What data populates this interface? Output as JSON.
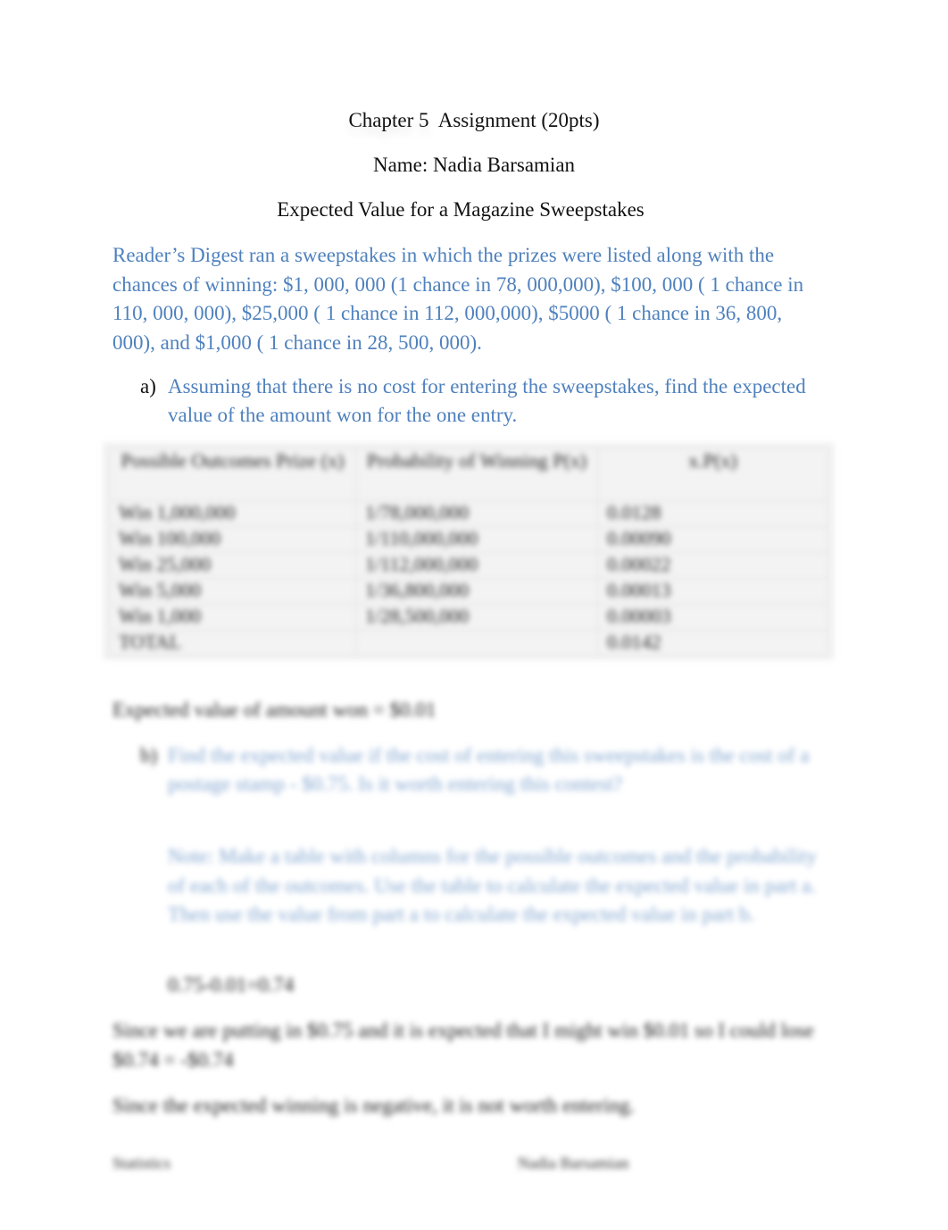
{
  "document": {
    "title_chapter": "Chapter 5",
    "title_rest": "Assignment (20pts)",
    "name_line": "Name: Nadia Barsamian",
    "subtitle": "Expected Value for a Magazine Sweepstakes",
    "intro": "Reader’s Digest ran a sweepstakes in which the prizes were listed along with the chances of winning: $1, 000, 000 (1 chance in 78, 000,000), $100, 000 ( 1 chance in 110, 000, 000), $25,000 ( 1 chance in 112, 000,000),  $5000 ( 1 chance in 36, 800, 000), and $1,000 ( 1 chance in 28, 500, 000).",
    "question_a": {
      "label": "a)",
      "text": "Assuming that there is no cost for entering the sweepstakes, find the expected value of the amount won for the one entry."
    },
    "table": {
      "headers": [
        "Possible Outcomes Prize (x)",
        "Probability of Winning P(x)",
        "x.P(x)"
      ],
      "rows": [
        [
          "Win 1,000,000",
          "1/78,000,000",
          "0.0128"
        ],
        [
          "Win 100,000",
          "1/110,000,000",
          "0.00090"
        ],
        [
          "Win 25,000",
          "1/112,000,000",
          "0.00022"
        ],
        [
          "Win 5,000",
          "1/36,800,000",
          "0.00013"
        ],
        [
          "Win 1,000",
          "1/28,500,000",
          "0.00003"
        ],
        [
          "TOTAL",
          "",
          "0.0142"
        ]
      ]
    },
    "expected_value_line": "Expected value of amount won = $0.01",
    "question_b": {
      "label": "b)",
      "text": "Find the expected value if the cost of entering this sweepstakes is the cost of a postage stamp - $0.75. Is it worth entering this contest?"
    },
    "note": "Note: Make a table with columns for the possible outcomes and the probability of each of the outcomes. Use the table to calculate the expected value in part a. Then use the value from part a to calculate the expected value in part b.",
    "calc_line": "0.75-0.01=0.74",
    "answer_p1": "Since we are putting in $0.75 and it is expected that I might win $0.01 so I could lose $0.74 = -$0.74",
    "answer_p2": "Since the expected winning is negative, it is not worth entering.",
    "footer_left": "Statistics",
    "footer_right": "Nadia Barsamian"
  }
}
